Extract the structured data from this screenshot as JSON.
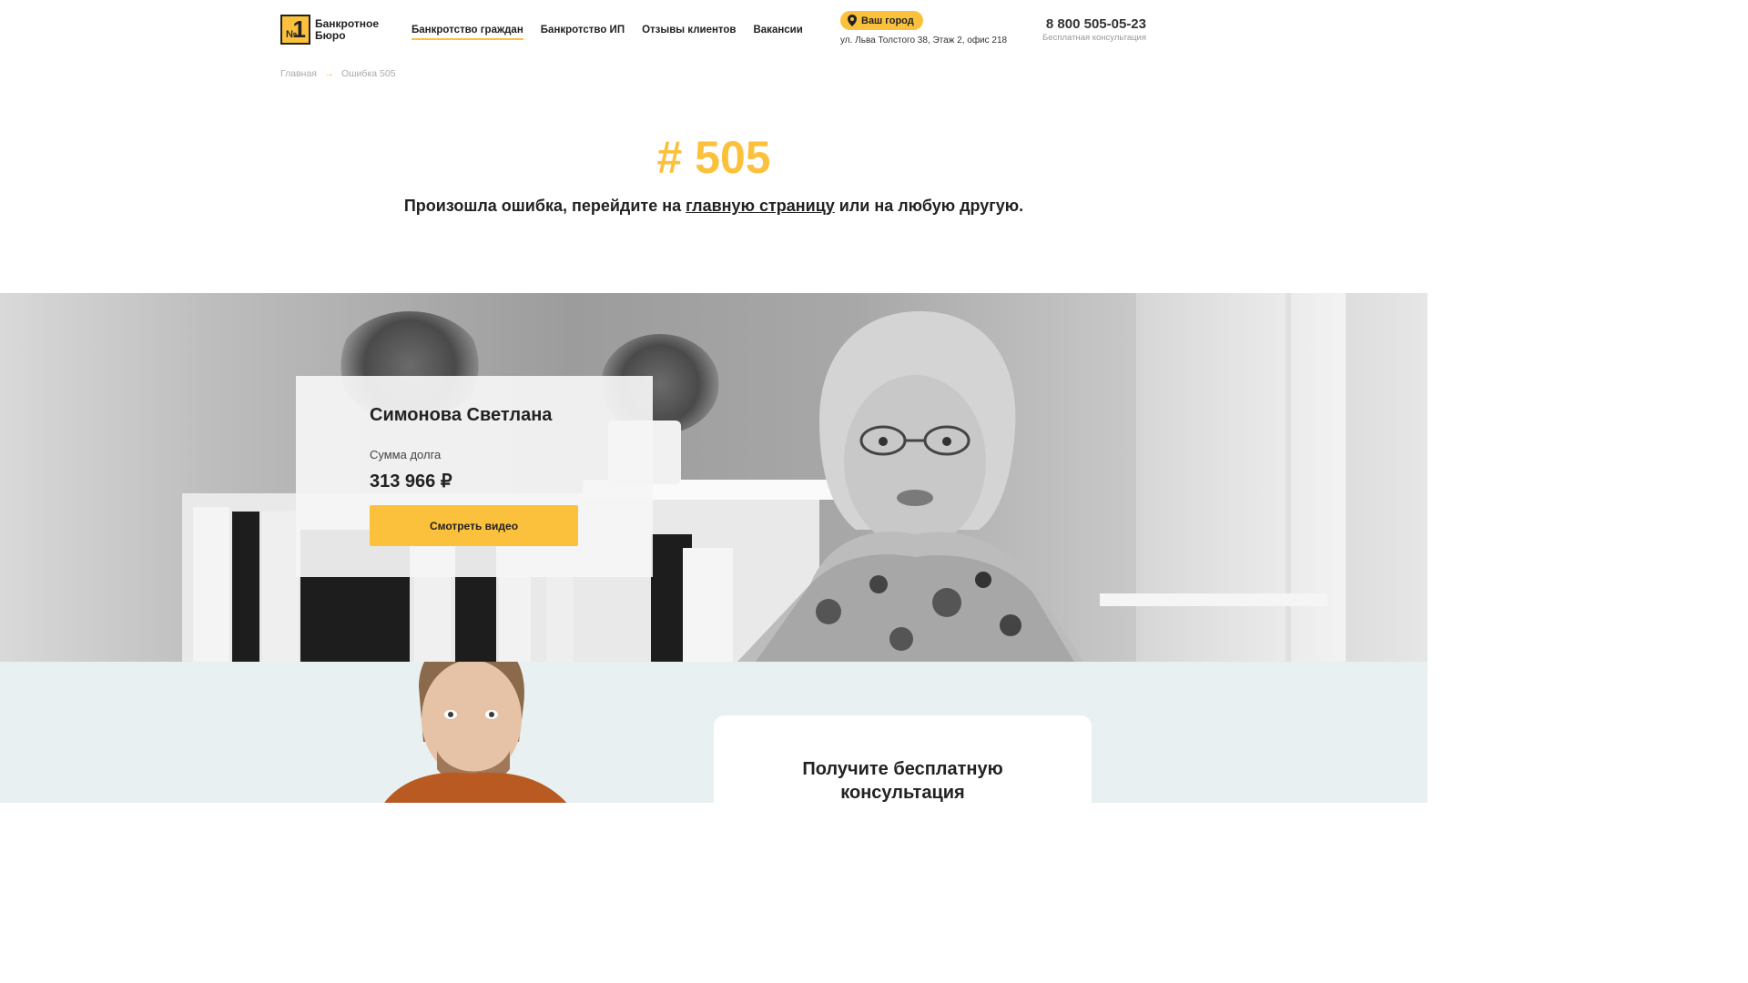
{
  "header": {
    "logo": {
      "mark_symbol": "№",
      "mark_number": "1",
      "text": "Банкротное Бюро"
    },
    "nav": [
      {
        "label": "Банкротство граждан",
        "active": true
      },
      {
        "label": "Банкротство ИП",
        "active": false
      },
      {
        "label": "Отзывы клиентов",
        "active": false
      },
      {
        "label": "Вакансии",
        "active": false
      }
    ],
    "city_button": "Ваш город",
    "address": "ул. Льва Толстого 38, Этаж 2, офис 218",
    "phone": "8 800 505-05-23",
    "phone_caption": "Бесплатная консультация"
  },
  "breadcrumb": {
    "home": "Главная",
    "current": "Ошибка 505"
  },
  "error": {
    "code": "# 505",
    "message_before": "Произошла ошибка, перейдите на ",
    "message_link": "главную страницу",
    "message_after": " или на любую другую."
  },
  "testimonial": {
    "name": "Симонова Светлана",
    "debt_label": "Сумма долга",
    "debt_amount": "313 966 ₽",
    "button": "Смотреть видео"
  },
  "consultation": {
    "title": "Получите бесплатную консультация"
  },
  "colors": {
    "accent": "#fbc13d",
    "text": "#222222",
    "muted": "#aaaaaa",
    "bottom_bg": "#e8f0f2"
  },
  "icons": [
    "map-pin-icon",
    "arrow-right-icon"
  ]
}
